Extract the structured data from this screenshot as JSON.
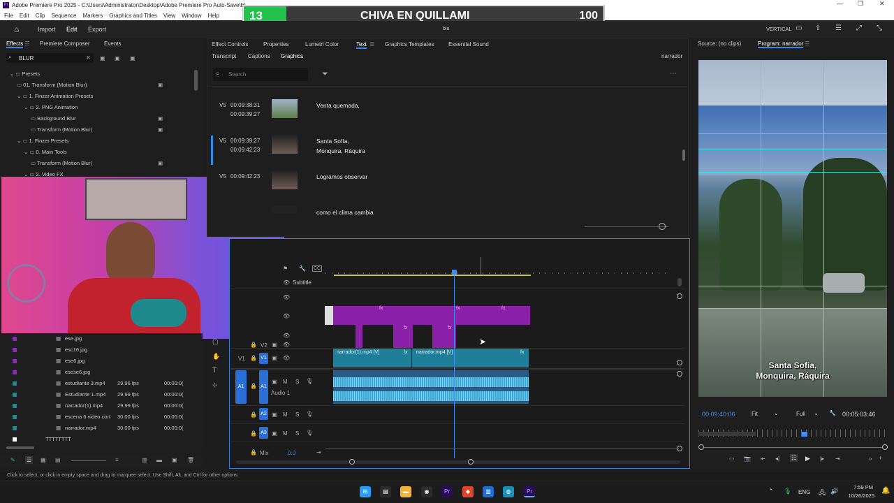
{
  "window": {
    "title": "Adobe Premiere Pro 2025 - C:\\Users\\Administrator\\Desktop\\Adobe Premiere Pro Auto-Save\\bl",
    "app_icon": "Pr",
    "minimize": "—",
    "maximize": "❐",
    "close": "✕"
  },
  "menu": [
    "File",
    "Edit",
    "Clip",
    "Sequence",
    "Markers",
    "Graphics and Titles",
    "View",
    "Window",
    "Help"
  ],
  "scoreboard": {
    "left": "13",
    "title": "CHIVA EN QUILLAMI",
    "right": "100"
  },
  "appbar": {
    "home_icon": "home-icon",
    "tabs": [
      "Import",
      "Edit",
      "Export"
    ],
    "project": "blu",
    "layout": "VERTICAL"
  },
  "effects_panel": {
    "tabs": [
      "Effects",
      "Premiere Composer",
      "Events"
    ],
    "search_value": "BLUR",
    "tree": [
      {
        "label": "Presets",
        "indent": 0
      },
      {
        "label": "01. Transform (Motion Blur)",
        "indent": 1
      },
      {
        "label": "1. Finzer Animation Presets",
        "indent": 1
      },
      {
        "label": "2. PNG Animation",
        "indent": 2
      },
      {
        "label": "Background Blur",
        "indent": 3
      },
      {
        "label": "Transform (Motion Blur)",
        "indent": 3
      },
      {
        "label": "1. Finzer Presets",
        "indent": 1
      },
      {
        "label": "0. Main Tools",
        "indent": 2
      },
      {
        "label": "Transform (Motion Blur)",
        "indent": 3
      },
      {
        "label": "2. Video FX",
        "indent": 2
      }
    ]
  },
  "project_list": [
    {
      "name": "ese.jpg",
      "fps": "",
      "dur": "",
      "color": "#8a2ab8"
    },
    {
      "name": "esc16.jpg",
      "fps": "",
      "dur": "",
      "color": "#8a2ab8"
    },
    {
      "name": "ese6.jpg",
      "fps": "",
      "dur": "",
      "color": "#8a2ab8"
    },
    {
      "name": "esese6.jpg",
      "fps": "",
      "dur": "",
      "color": "#8a2ab8"
    },
    {
      "name": "estudiante 3.mp4",
      "fps": "29.96 fps",
      "dur": "00:00:0(",
      "color": "#1f8a8a"
    },
    {
      "name": "Estudiante 1.mp4",
      "fps": "29.99 fps",
      "dur": "00:00:0(",
      "color": "#1f8a8a"
    },
    {
      "name": "narrador(1).mp4",
      "fps": "29.99 fps",
      "dur": "00:00:0(",
      "color": "#1f8a8a"
    },
    {
      "name": "escena 6 video cort",
      "fps": "30.00 fps",
      "dur": "00:00:0(",
      "color": "#1f8a8a"
    },
    {
      "name": "narrador.mp4",
      "fps": "30.00 fps",
      "dur": "00:00:0(",
      "color": "#1f8a8a"
    },
    {
      "name": "TTTTTTTT",
      "fps": "",
      "dur": "",
      "color": "#ffffff"
    }
  ],
  "text_panel": {
    "tabs_top": [
      "Effect Controls",
      "Properties",
      "Lumetri Color",
      "Text",
      "Graphics Templates",
      "Essential Sound"
    ],
    "tabs_sub": [
      "Transcript",
      "Captions",
      "Graphics"
    ],
    "right_label": "narrador",
    "search_placeholder": "Search",
    "rows": [
      {
        "track": "V5",
        "in": "00:09:38:31",
        "out": "00:09:39:27",
        "text": "Venta quemada,",
        "text2": ""
      },
      {
        "track": "V5",
        "in": "00:09:39:27",
        "out": "00:09:42:23",
        "text": "Santa Sofía,",
        "text2": "Monquira, Ráquira"
      },
      {
        "track": "V5",
        "in": "00:09:42:23",
        "out": "",
        "text": "Logramos observar",
        "text2": ""
      },
      {
        "track": "",
        "in": "",
        "out": "",
        "text": "como el clima cambia",
        "text2": ""
      }
    ]
  },
  "timeline": {
    "subtitle_label": "Subtitle",
    "v2": "V2",
    "v1": "V1",
    "a1": "A1",
    "a2": "A2",
    "a3": "A3",
    "audio1": "Audio 1",
    "mix": "Mix",
    "mix_val": "0.0",
    "clip_v1a": "narrador(1).mp4 [V]",
    "clip_v1b": "narrador.mp4 [V]",
    "fx": "fx",
    "m": "M",
    "s": "S"
  },
  "program": {
    "source_tab": "Source: (no clips)",
    "program_tab": "Program: narrador",
    "caption_line1": "Santa Sofia,",
    "caption_line2": "Monquira, Ráquira",
    "timecode": "00:09:40:06",
    "fit": "Fit",
    "full": "Full",
    "duration": "00:05:03:46"
  },
  "status": {
    "hint": "Click to select, or click in empty space and drag to marquee select. Use Shift, Alt, and Ctrl for other options."
  },
  "taskbar": {
    "lang": "ENG",
    "time": "7:59 PM",
    "date": "10/26/2025"
  },
  "colors": {
    "accent": "#2d8ceb",
    "purple": "#8a1fa8",
    "teal": "#1f7e98",
    "audio": "#3fa7d6",
    "green": "#21c34d"
  }
}
